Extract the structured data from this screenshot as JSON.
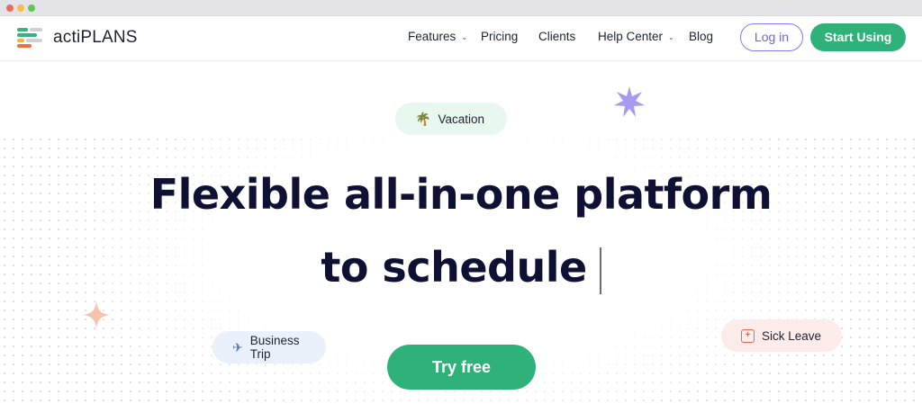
{
  "header": {
    "logo_text": "actiPLANS",
    "nav": {
      "features": "Features",
      "pricing": "Pricing",
      "clients": "Clients",
      "help_center": "Help Center",
      "blog": "Blog"
    },
    "login_label": "Log in",
    "start_label": "Start Using"
  },
  "hero": {
    "headline_line1": "Flexible all-in-one platform",
    "headline_line2": "to schedule",
    "cta_label": "Try free",
    "tags": {
      "vacation": "Vacation",
      "business_trip": "Business Trip",
      "sick_leave": "Sick Leave"
    }
  },
  "icons": {
    "vacation": "palm-tree-icon",
    "business_trip": "airplane-icon",
    "sick_leave": "medical-plus-icon",
    "nav_dropdown": "chevron-down-icon"
  },
  "colors": {
    "brand_green": "#2fb27a",
    "accent_purple": "#7d7ff0",
    "headline": "#0f1134",
    "star_purple": "#a89af0",
    "spark_peach": "#f6c3ae"
  }
}
